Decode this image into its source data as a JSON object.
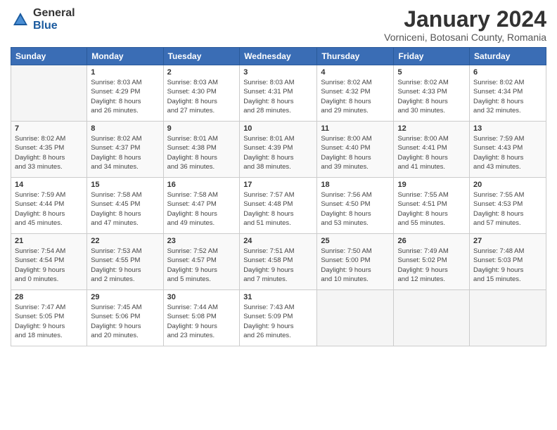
{
  "logo": {
    "general": "General",
    "blue": "Blue"
  },
  "title": "January 2024",
  "subtitle": "Vorniceni, Botosani County, Romania",
  "days_of_week": [
    "Sunday",
    "Monday",
    "Tuesday",
    "Wednesday",
    "Thursday",
    "Friday",
    "Saturday"
  ],
  "weeks": [
    [
      {
        "day": "",
        "info": ""
      },
      {
        "day": "1",
        "info": "Sunrise: 8:03 AM\nSunset: 4:29 PM\nDaylight: 8 hours\nand 26 minutes."
      },
      {
        "day": "2",
        "info": "Sunrise: 8:03 AM\nSunset: 4:30 PM\nDaylight: 8 hours\nand 27 minutes."
      },
      {
        "day": "3",
        "info": "Sunrise: 8:03 AM\nSunset: 4:31 PM\nDaylight: 8 hours\nand 28 minutes."
      },
      {
        "day": "4",
        "info": "Sunrise: 8:02 AM\nSunset: 4:32 PM\nDaylight: 8 hours\nand 29 minutes."
      },
      {
        "day": "5",
        "info": "Sunrise: 8:02 AM\nSunset: 4:33 PM\nDaylight: 8 hours\nand 30 minutes."
      },
      {
        "day": "6",
        "info": "Sunrise: 8:02 AM\nSunset: 4:34 PM\nDaylight: 8 hours\nand 32 minutes."
      }
    ],
    [
      {
        "day": "7",
        "info": "Sunrise: 8:02 AM\nSunset: 4:35 PM\nDaylight: 8 hours\nand 33 minutes."
      },
      {
        "day": "8",
        "info": "Sunrise: 8:02 AM\nSunset: 4:37 PM\nDaylight: 8 hours\nand 34 minutes."
      },
      {
        "day": "9",
        "info": "Sunrise: 8:01 AM\nSunset: 4:38 PM\nDaylight: 8 hours\nand 36 minutes."
      },
      {
        "day": "10",
        "info": "Sunrise: 8:01 AM\nSunset: 4:39 PM\nDaylight: 8 hours\nand 38 minutes."
      },
      {
        "day": "11",
        "info": "Sunrise: 8:00 AM\nSunset: 4:40 PM\nDaylight: 8 hours\nand 39 minutes."
      },
      {
        "day": "12",
        "info": "Sunrise: 8:00 AM\nSunset: 4:41 PM\nDaylight: 8 hours\nand 41 minutes."
      },
      {
        "day": "13",
        "info": "Sunrise: 7:59 AM\nSunset: 4:43 PM\nDaylight: 8 hours\nand 43 minutes."
      }
    ],
    [
      {
        "day": "14",
        "info": "Sunrise: 7:59 AM\nSunset: 4:44 PM\nDaylight: 8 hours\nand 45 minutes."
      },
      {
        "day": "15",
        "info": "Sunrise: 7:58 AM\nSunset: 4:45 PM\nDaylight: 8 hours\nand 47 minutes."
      },
      {
        "day": "16",
        "info": "Sunrise: 7:58 AM\nSunset: 4:47 PM\nDaylight: 8 hours\nand 49 minutes."
      },
      {
        "day": "17",
        "info": "Sunrise: 7:57 AM\nSunset: 4:48 PM\nDaylight: 8 hours\nand 51 minutes."
      },
      {
        "day": "18",
        "info": "Sunrise: 7:56 AM\nSunset: 4:50 PM\nDaylight: 8 hours\nand 53 minutes."
      },
      {
        "day": "19",
        "info": "Sunrise: 7:55 AM\nSunset: 4:51 PM\nDaylight: 8 hours\nand 55 minutes."
      },
      {
        "day": "20",
        "info": "Sunrise: 7:55 AM\nSunset: 4:53 PM\nDaylight: 8 hours\nand 57 minutes."
      }
    ],
    [
      {
        "day": "21",
        "info": "Sunrise: 7:54 AM\nSunset: 4:54 PM\nDaylight: 9 hours\nand 0 minutes."
      },
      {
        "day": "22",
        "info": "Sunrise: 7:53 AM\nSunset: 4:55 PM\nDaylight: 9 hours\nand 2 minutes."
      },
      {
        "day": "23",
        "info": "Sunrise: 7:52 AM\nSunset: 4:57 PM\nDaylight: 9 hours\nand 5 minutes."
      },
      {
        "day": "24",
        "info": "Sunrise: 7:51 AM\nSunset: 4:58 PM\nDaylight: 9 hours\nand 7 minutes."
      },
      {
        "day": "25",
        "info": "Sunrise: 7:50 AM\nSunset: 5:00 PM\nDaylight: 9 hours\nand 10 minutes."
      },
      {
        "day": "26",
        "info": "Sunrise: 7:49 AM\nSunset: 5:02 PM\nDaylight: 9 hours\nand 12 minutes."
      },
      {
        "day": "27",
        "info": "Sunrise: 7:48 AM\nSunset: 5:03 PM\nDaylight: 9 hours\nand 15 minutes."
      }
    ],
    [
      {
        "day": "28",
        "info": "Sunrise: 7:47 AM\nSunset: 5:05 PM\nDaylight: 9 hours\nand 18 minutes."
      },
      {
        "day": "29",
        "info": "Sunrise: 7:45 AM\nSunset: 5:06 PM\nDaylight: 9 hours\nand 20 minutes."
      },
      {
        "day": "30",
        "info": "Sunrise: 7:44 AM\nSunset: 5:08 PM\nDaylight: 9 hours\nand 23 minutes."
      },
      {
        "day": "31",
        "info": "Sunrise: 7:43 AM\nSunset: 5:09 PM\nDaylight: 9 hours\nand 26 minutes."
      },
      {
        "day": "",
        "info": ""
      },
      {
        "day": "",
        "info": ""
      },
      {
        "day": "",
        "info": ""
      }
    ]
  ]
}
